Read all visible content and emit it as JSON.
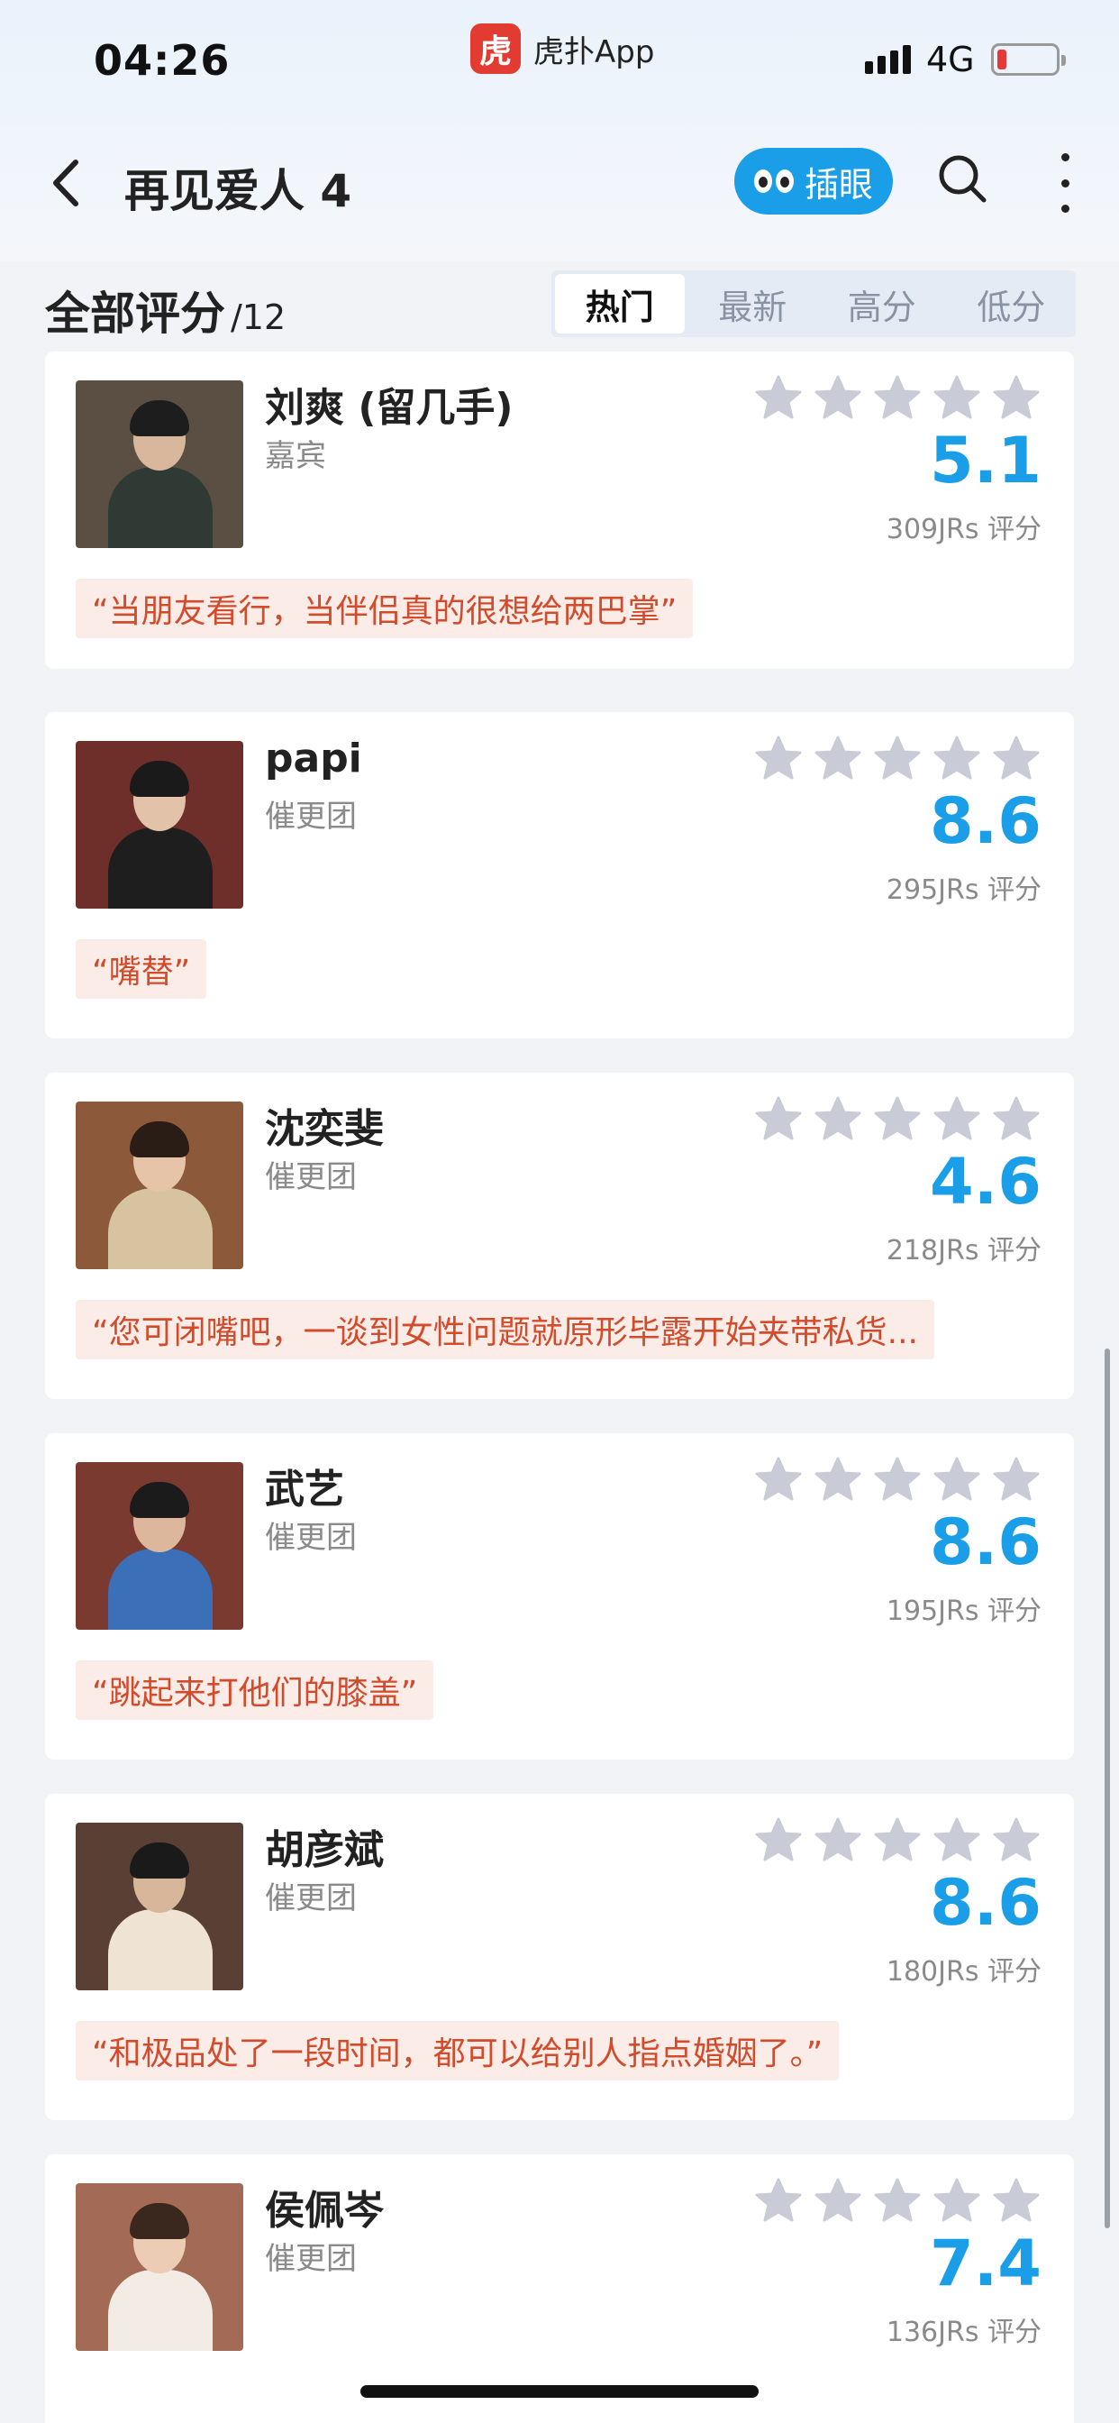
{
  "status_bar": {
    "time": "04:26",
    "app_logo_char": "虎",
    "app_name": "虎扑App",
    "network": "4G"
  },
  "nav": {
    "title": "再见爱人 4",
    "chayan_label": "插眼"
  },
  "section": {
    "title": "全部评分",
    "count": "/12",
    "tabs": [
      "热门",
      "最新",
      "高分",
      "低分"
    ],
    "active_tab": "热门"
  },
  "cards": [
    {
      "name": "刘爽 (留几手)",
      "role": "嘉宾",
      "score": "5.1",
      "votes": "309JRs 评分",
      "quote": "“当朋友看行，当伴侣真的很想给两巴掌”"
    },
    {
      "name": "papi",
      "role": "催更团",
      "score": "8.6",
      "votes": "295JRs 评分",
      "quote": "“嘴替”"
    },
    {
      "name": "沈奕斐",
      "role": "催更团",
      "score": "4.6",
      "votes": "218JRs 评分",
      "quote": "“您可闭嘴吧，一谈到女性问题就原形毕露开始夹带私货..."
    },
    {
      "name": "武艺",
      "role": "催更团",
      "score": "8.6",
      "votes": "195JRs 评分",
      "quote": "“跳起来打他们的膝盖”"
    },
    {
      "name": "胡彦斌",
      "role": "催更团",
      "score": "8.6",
      "votes": "180JRs 评分",
      "quote": "“和极品处了一段时间，都可以给别人指点婚姻了。”"
    },
    {
      "name": "侯佩岑",
      "role": "催更团",
      "score": "7.4",
      "votes": "136JRs 评分",
      "quote": ""
    }
  ],
  "colors": {
    "accent": "#1a9ee8",
    "quote_text": "#d24b2b",
    "quote_bg": "#fbece8",
    "star": "#c9ccd6"
  }
}
